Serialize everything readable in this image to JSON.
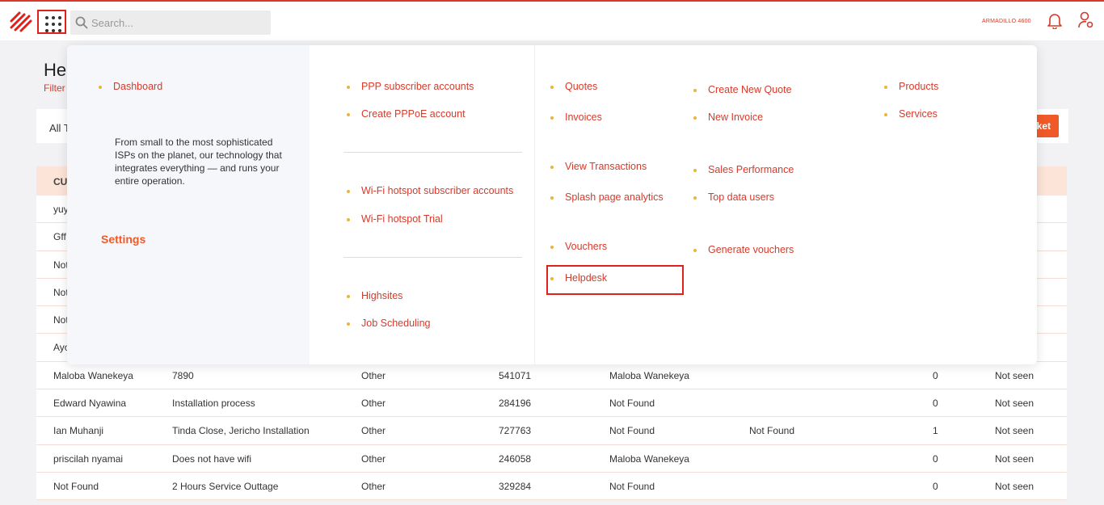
{
  "header": {
    "search_placeholder": "Search...",
    "account_name": "ARMADILLO 4600"
  },
  "page": {
    "title": "Hel",
    "subtitle": "Filter",
    "filter_label": "All T",
    "new_ticket_label": "ket",
    "column_header": "CU"
  },
  "table": {
    "hidden_rows": [
      "yuy",
      "Gff",
      "Not",
      "Not",
      "Not",
      "Ayo"
    ],
    "rows": [
      [
        "Maloba Wanekeya",
        "7890",
        "Other",
        "541071",
        "Maloba Wanekeya",
        "",
        "0",
        "Not seen"
      ],
      [
        "Edward Nyawina",
        "Installation process",
        "Other",
        "284196",
        "Not Found",
        "",
        "0",
        "Not seen"
      ],
      [
        "Ian Muhanji",
        "Tinda Close, Jericho Installation",
        "Other",
        "727763",
        "Not Found",
        "Not Found",
        "1",
        "Not seen"
      ],
      [
        "priscilah nyamai",
        "Does not have wifi",
        "Other",
        "246058",
        "Maloba Wanekeya",
        "",
        "0",
        "Not seen"
      ],
      [
        "Not Found",
        "2 Hours Service Outtage",
        "Other",
        "329284",
        "Not Found",
        "",
        "0",
        "Not seen"
      ]
    ]
  },
  "menu": {
    "dashboard": "Dashboard",
    "description": "From small to the most sophisticated ISPs on the planet, our technology that integrates everything — and runs your entire operation.",
    "settings": "Settings",
    "ppp_accounts": "PPP subscriber accounts",
    "create_pppoe": "Create PPPoE account",
    "wifi_accounts": "Wi-Fi hotspot subscriber accounts",
    "wifi_trial": "Wi-Fi hotspot Trial",
    "highsites": "Highsites",
    "job_scheduling": "Job Scheduling",
    "quotes": "Quotes",
    "invoices": "Invoices",
    "view_transactions": "View Transactions",
    "splash_analytics": "Splash page analytics",
    "vouchers": "Vouchers",
    "helpdesk": "Helpdesk",
    "create_quote": "Create New Quote",
    "new_invoice": "New Invoice",
    "sales_performance": "Sales Performance",
    "top_data_users": "Top data users",
    "generate_vouchers": "Generate vouchers",
    "products": "Products",
    "services": "Services"
  },
  "colors": {
    "accent": "#d63a2a",
    "button": "#f05a28",
    "bullet": "#f0b33a",
    "highlight": "#e0201a"
  }
}
